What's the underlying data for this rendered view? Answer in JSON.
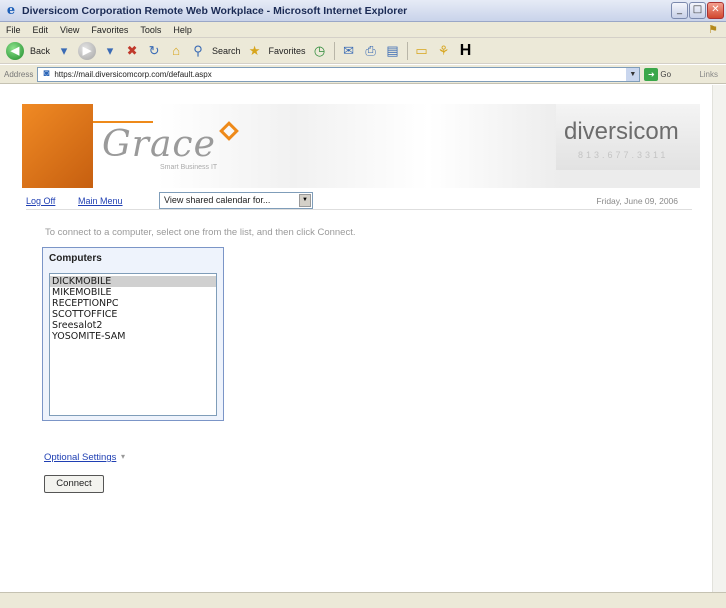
{
  "window": {
    "title": "Diversicom Corporation Remote Web Workplace - Microsoft Internet Explorer",
    "min_label": "_",
    "max_label": "□",
    "close_label": "✕"
  },
  "menu": [
    "File",
    "Edit",
    "View",
    "Favorites",
    "Tools",
    "Help"
  ],
  "toolbar": {
    "back_label": "Back",
    "search_label": "Search",
    "favorites_label": "Favorites"
  },
  "address": {
    "label": "Address",
    "url": "https://mail.diversicomcorp.com/default.aspx",
    "go_label": "Go",
    "links_label": "Links"
  },
  "banner": {
    "logo_text": "Grace",
    "logo_subtitle": "Smart Business IT",
    "brand_text": "diversicom",
    "phone": "813.677.3311"
  },
  "nav": {
    "log_off": "Log Off",
    "main_menu": "Main Menu",
    "calendar_select": "View shared calendar for...",
    "date": "Friday, June 09, 2006"
  },
  "main": {
    "instruction": "To connect to a computer, select one from the list, and then click Connect.",
    "panel_title": "Computers",
    "computers": [
      "DICKMOBILE",
      "MIKEMOBILE",
      "RECEPTIONPC",
      "SCOTTOFFICE",
      "Sreesalot2",
      "YOSOMITE-SAM"
    ],
    "selected_index": 0,
    "optional_settings": "Optional Settings",
    "connect_label": "Connect"
  },
  "colors": {
    "link": "#1f3fb3",
    "accent_orange": "#ee8a1a",
    "panel_border": "#7b95c7"
  }
}
